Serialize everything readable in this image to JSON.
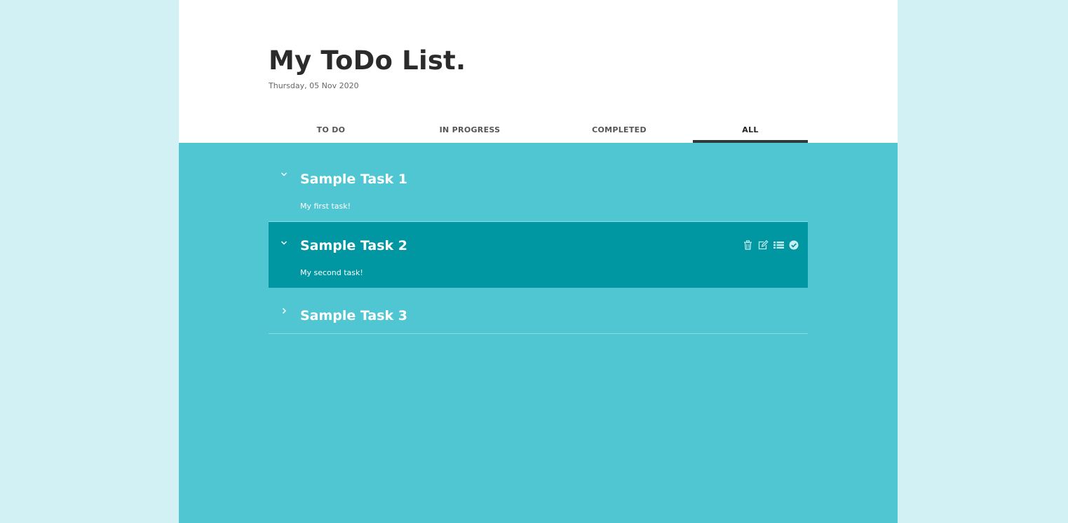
{
  "header": {
    "title": "My ToDo List.",
    "date": "Thursday, 05 Nov 2020"
  },
  "tabs": [
    {
      "label": "TO DO",
      "active": false
    },
    {
      "label": "IN PROGRESS",
      "active": false
    },
    {
      "label": "COMPLETED",
      "active": false
    },
    {
      "label": "ALL",
      "active": true
    }
  ],
  "tasks": [
    {
      "title": "Sample Task 1",
      "description": "My first task!",
      "expanded": true,
      "selected": false
    },
    {
      "title": "Sample Task 2",
      "description": "My second task!",
      "expanded": true,
      "selected": true,
      "actions": [
        "trash-icon",
        "edit-icon",
        "list-icon",
        "check-circle-icon"
      ]
    },
    {
      "title": "Sample Task 3",
      "description": "",
      "expanded": false,
      "selected": false
    }
  ],
  "colors": {
    "page_background": "#d2f1f4",
    "content_background": "#4fc6d2",
    "selected_task": "#0096a2",
    "active_tab_underline": "#2f3a3d",
    "title_text": "#2b2b2b"
  }
}
